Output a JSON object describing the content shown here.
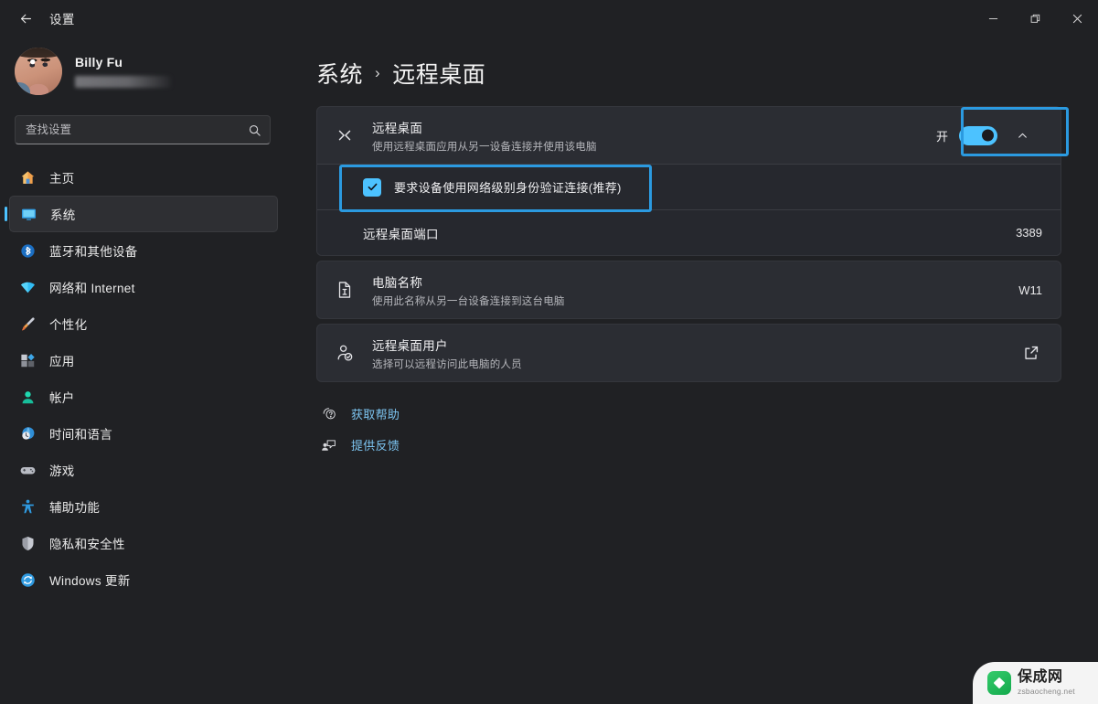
{
  "window": {
    "title": "设置",
    "back_icon": "arrow-left-icon",
    "controls": {
      "minimize": "minimize-icon",
      "maximize": "restore-icon",
      "close": "close-icon"
    }
  },
  "sidebar": {
    "profile": {
      "name": "Billy Fu",
      "email_redacted": true
    },
    "search": {
      "placeholder": "查找设置",
      "value": "",
      "icon": "search-icon"
    },
    "items": [
      {
        "label": "主页",
        "icon": "home-icon",
        "selected": false
      },
      {
        "label": "系统",
        "icon": "system-monitor-icon",
        "selected": true
      },
      {
        "label": "蓝牙和其他设备",
        "icon": "bluetooth-icon",
        "selected": false
      },
      {
        "label": "网络和 Internet",
        "icon": "wifi-icon",
        "selected": false
      },
      {
        "label": "个性化",
        "icon": "brush-icon",
        "selected": false
      },
      {
        "label": "应用",
        "icon": "apps-icon",
        "selected": false
      },
      {
        "label": "帐户",
        "icon": "account-icon",
        "selected": false
      },
      {
        "label": "时间和语言",
        "icon": "clock-globe-icon",
        "selected": false
      },
      {
        "label": "游戏",
        "icon": "gamepad-icon",
        "selected": false
      },
      {
        "label": "辅助功能",
        "icon": "accessibility-icon",
        "selected": false
      },
      {
        "label": "隐私和安全性",
        "icon": "shield-icon",
        "selected": false
      },
      {
        "label": "Windows 更新",
        "icon": "update-icon",
        "selected": false
      }
    ]
  },
  "breadcrumb": {
    "parent": "系统",
    "separator": "›",
    "current": "远程桌面"
  },
  "main": {
    "remote_desktop": {
      "icon": "remote-desktop-icon",
      "title": "远程桌面",
      "subtitle": "使用远程桌面应用从另一设备连接并使用该电脑",
      "toggle_label": "开",
      "toggle_on": true,
      "expander_icon": "chevron-up-icon"
    },
    "nla": {
      "checked": true,
      "check_icon": "checkmark-icon",
      "label": "要求设备使用网络级别身份验证连接(推荐)"
    },
    "port": {
      "label": "远程桌面端口",
      "value": "3389"
    },
    "pc_name": {
      "icon": "rename-document-icon",
      "title": "电脑名称",
      "subtitle": "使用此名称从另一台设备连接到这台电脑",
      "value": "W11"
    },
    "rd_users": {
      "icon": "user-check-icon",
      "title": "远程桌面用户",
      "subtitle": "选择可以远程访问此电脑的人员",
      "action_icon": "external-link-icon"
    },
    "links": [
      {
        "label": "获取帮助",
        "icon": "help-icon"
      },
      {
        "label": "提供反馈",
        "icon": "feedback-icon"
      }
    ]
  },
  "watermark": {
    "name": "保成网",
    "url": "zsbaocheng.net",
    "icon": "shield-logo-icon"
  },
  "colors": {
    "accent": "#4cc2ff",
    "annotation": "#2b9ae0",
    "link": "#7cc4f0",
    "card_bg": "#2b2d33",
    "app_bg": "#202124"
  }
}
